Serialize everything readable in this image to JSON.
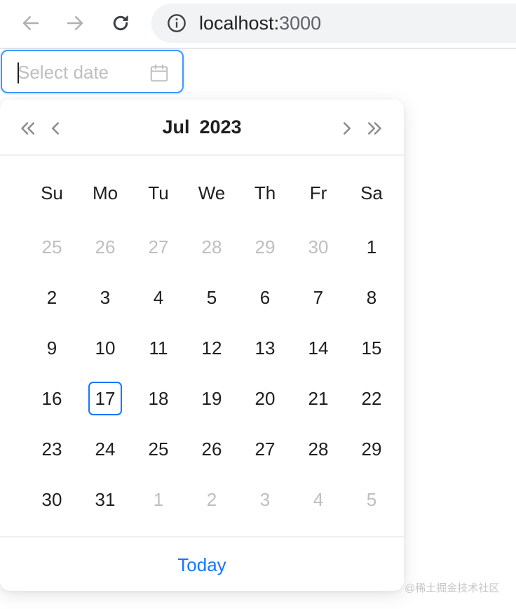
{
  "browser": {
    "url_host": "localhost:",
    "url_port": "3000"
  },
  "date_picker": {
    "placeholder": "Select date",
    "focused": true,
    "accent_color": "#1677ff",
    "header": {
      "month": "Jul",
      "year": "2023"
    },
    "weekdays": [
      "Su",
      "Mo",
      "Tu",
      "We",
      "Th",
      "Fr",
      "Sa"
    ],
    "weeks": [
      [
        {
          "d": "25",
          "other": true
        },
        {
          "d": "26",
          "other": true
        },
        {
          "d": "27",
          "other": true
        },
        {
          "d": "28",
          "other": true
        },
        {
          "d": "29",
          "other": true
        },
        {
          "d": "30",
          "other": true
        },
        {
          "d": "1"
        }
      ],
      [
        {
          "d": "2"
        },
        {
          "d": "3"
        },
        {
          "d": "4"
        },
        {
          "d": "5"
        },
        {
          "d": "6"
        },
        {
          "d": "7"
        },
        {
          "d": "8"
        }
      ],
      [
        {
          "d": "9"
        },
        {
          "d": "10"
        },
        {
          "d": "11"
        },
        {
          "d": "12"
        },
        {
          "d": "13"
        },
        {
          "d": "14"
        },
        {
          "d": "15"
        }
      ],
      [
        {
          "d": "16"
        },
        {
          "d": "17",
          "today": true
        },
        {
          "d": "18"
        },
        {
          "d": "19"
        },
        {
          "d": "20"
        },
        {
          "d": "21"
        },
        {
          "d": "22"
        }
      ],
      [
        {
          "d": "23"
        },
        {
          "d": "24"
        },
        {
          "d": "25"
        },
        {
          "d": "26"
        },
        {
          "d": "27"
        },
        {
          "d": "28"
        },
        {
          "d": "29"
        }
      ],
      [
        {
          "d": "30"
        },
        {
          "d": "31"
        },
        {
          "d": "1",
          "other": true
        },
        {
          "d": "2",
          "other": true
        },
        {
          "d": "3",
          "other": true
        },
        {
          "d": "4",
          "other": true
        },
        {
          "d": "5",
          "other": true
        }
      ]
    ],
    "footer": {
      "today_label": "Today"
    }
  },
  "watermark": "@稀土掘金技术社区"
}
